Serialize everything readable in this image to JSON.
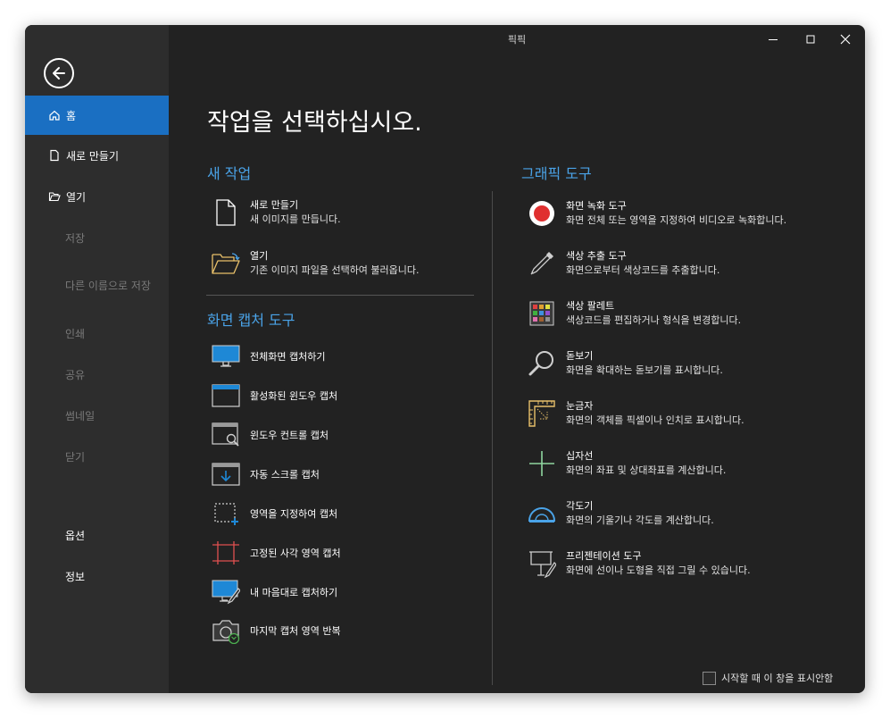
{
  "window": {
    "title": "픽픽"
  },
  "sidebar": {
    "items": [
      {
        "label": "홈",
        "state": "active"
      },
      {
        "label": "새로 만들기",
        "state": "normal"
      },
      {
        "label": "열기",
        "state": "normal"
      },
      {
        "label": "저장",
        "state": "disabled"
      },
      {
        "label": "다른 이름으로 저장",
        "state": "disabled"
      },
      {
        "label": "인쇄",
        "state": "disabled"
      },
      {
        "label": "공유",
        "state": "disabled"
      },
      {
        "label": "썸네일",
        "state": "disabled"
      },
      {
        "label": "닫기",
        "state": "disabled"
      },
      {
        "label": "옵션",
        "state": "normal"
      },
      {
        "label": "정보",
        "state": "normal"
      }
    ]
  },
  "main": {
    "title": "작업을 선택하십시오.",
    "new_work": {
      "heading": "새 작업",
      "items": [
        {
          "title": "새로 만들기",
          "desc": "새 이미지를 만듭니다.",
          "icon": "new-file-icon"
        },
        {
          "title": "열기",
          "desc": "기존 이미지 파일을 선택하여 불러옵니다.",
          "icon": "open-folder-icon"
        }
      ]
    },
    "capture": {
      "heading": "화면 캡처 도구",
      "items": [
        {
          "label": "전체화면 캡처하기",
          "icon": "monitor-icon"
        },
        {
          "label": "활성화된 윈도우 캡처",
          "icon": "active-window-icon"
        },
        {
          "label": "윈도우 컨트롤 캡처",
          "icon": "window-control-icon"
        },
        {
          "label": "자동 스크롤 캡처",
          "icon": "scroll-capture-icon"
        },
        {
          "label": "영역을 지정하여 캡처",
          "icon": "region-select-icon"
        },
        {
          "label": "고정된 사각 영역 캡처",
          "icon": "fixed-region-icon"
        },
        {
          "label": "내 마음대로 캡처하기",
          "icon": "freehand-capture-icon"
        },
        {
          "label": "마지막 캡처 영역 반복",
          "icon": "repeat-capture-icon"
        }
      ]
    },
    "graphic": {
      "heading": "그래픽 도구",
      "items": [
        {
          "title": "화면 녹화 도구",
          "desc": "화면 전체 또는 영역을 지정하여 비디오로 녹화합니다.",
          "icon": "record-icon"
        },
        {
          "title": "색상 추출 도구",
          "desc": "화면으로부터 색상코드를 추출합니다.",
          "icon": "eyedropper-icon"
        },
        {
          "title": "색상 팔레트",
          "desc": "색상코드를 편집하거나 형식을 변경합니다.",
          "icon": "palette-icon"
        },
        {
          "title": "돋보기",
          "desc": "화면을 확대하는 돋보기를 표시합니다.",
          "icon": "magnifier-icon"
        },
        {
          "title": "눈금자",
          "desc": "화면의 객체를 픽셀이나 인치로 표시합니다.",
          "icon": "ruler-icon"
        },
        {
          "title": "십자선",
          "desc": "화면의 좌표 및 상대좌표를 계산합니다.",
          "icon": "crosshair-icon"
        },
        {
          "title": "각도기",
          "desc": "화면의 기울기나 각도를 계산합니다.",
          "icon": "protractor-icon"
        },
        {
          "title": "프리젠테이션 도구",
          "desc": "화면에 선이나 도형을 직접 그릴 수 있습니다.",
          "icon": "presentation-icon"
        }
      ]
    },
    "footer": {
      "checkbox_label": "시작할 때 이 창을 표시안함",
      "checked": false
    }
  },
  "colors": {
    "accent": "#1a6fc2",
    "heading": "#4aa3e8",
    "background": "#222222",
    "sidebar": "#2d2d2d"
  }
}
